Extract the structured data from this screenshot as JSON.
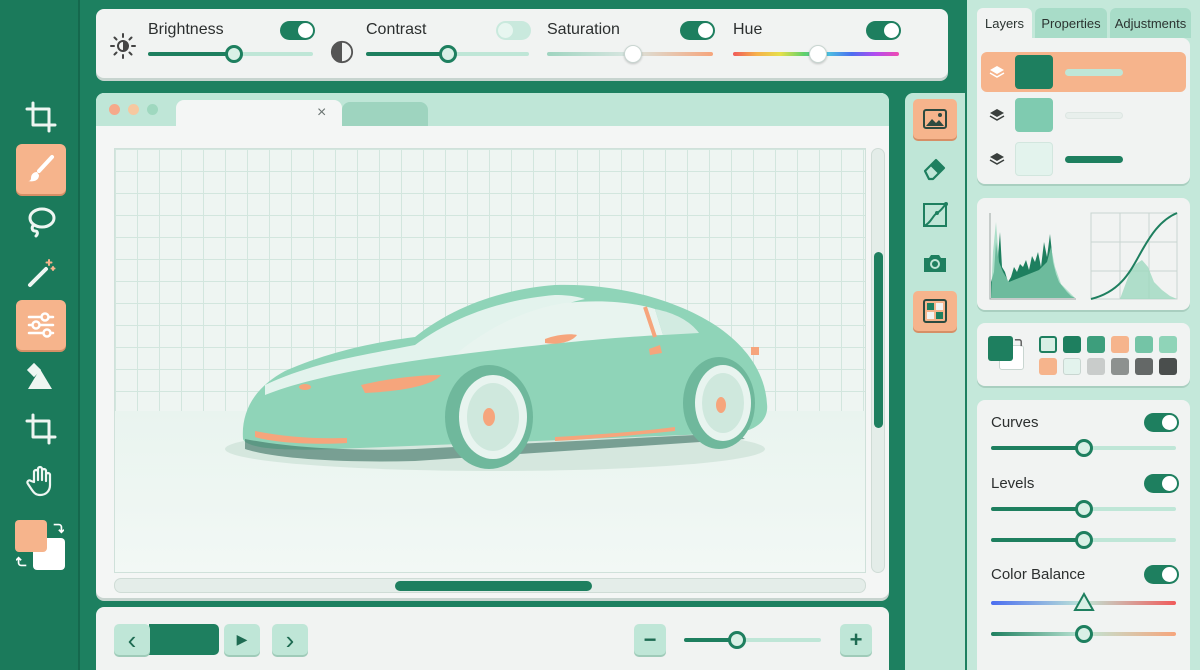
{
  "window": {
    "traffic_lights": [
      "#f6a98a",
      "#f6c8a0",
      "#9fd8bf"
    ]
  },
  "left_toolbar": {
    "tools": [
      {
        "name": "crop-icon",
        "active": false
      },
      {
        "name": "brush-icon",
        "active": true
      },
      {
        "name": "lasso-icon",
        "active": false
      },
      {
        "name": "magic-wand-icon",
        "active": false
      },
      {
        "name": "sliders-icon",
        "active": true
      },
      {
        "name": "shapes-icon",
        "active": false
      },
      {
        "name": "crop-icon",
        "active": false
      },
      {
        "name": "hand-icon",
        "active": false
      }
    ],
    "foreground_color": "#f6b48c",
    "background_color": "#ffffff"
  },
  "top_adjustments": {
    "brightness": {
      "label": "Brightness",
      "enabled": true,
      "value": 0.5
    },
    "contrast": {
      "label": "Contrast",
      "enabled": false,
      "value": 0.5
    },
    "saturation": {
      "label": "Saturation",
      "enabled": true,
      "value": 0.52
    },
    "hue": {
      "label": "Hue",
      "enabled": true,
      "value": 0.52
    }
  },
  "canvas": {
    "tab_close": "×",
    "colors": {
      "accent": "#1e7f5f",
      "car_body": "#8fd4b8",
      "car_accent": "#f6a57c"
    }
  },
  "bottom_bar": {
    "prev": "‹",
    "play": "▶",
    "next": "›",
    "zoom_out": "−",
    "zoom_in": "+",
    "zoom_value": 0.38
  },
  "right_panel": {
    "tabs": [
      {
        "label": "Layers",
        "active": true
      },
      {
        "label": "Properties",
        "active": false
      },
      {
        "label": "Adjustments",
        "active": false
      }
    ],
    "layers": [
      {
        "thumb": "#1e7f5f",
        "bar": "#bfe6d7",
        "selected": true
      },
      {
        "thumb": "#7fcbb0",
        "bar": "#e8efec",
        "selected": false
      },
      {
        "thumb": "#e3f3ed",
        "bar": "#1e7f5f",
        "selected": false
      }
    ],
    "swatches": [
      "#d8efe5",
      "#1e7f5f",
      "#3d9e7c",
      "#74c4a6",
      "#f6b48c",
      "#8fd4b8",
      "#f6b48c",
      "#e3f3ed",
      "#c9cccb",
      "#8d918f",
      "#646867",
      "#4a4e4d"
    ],
    "adjustments": [
      {
        "label": "Curves",
        "enabled": true
      },
      {
        "label": "Levels",
        "enabled": true
      },
      {
        "label": "Color Balance",
        "enabled": true
      }
    ]
  }
}
